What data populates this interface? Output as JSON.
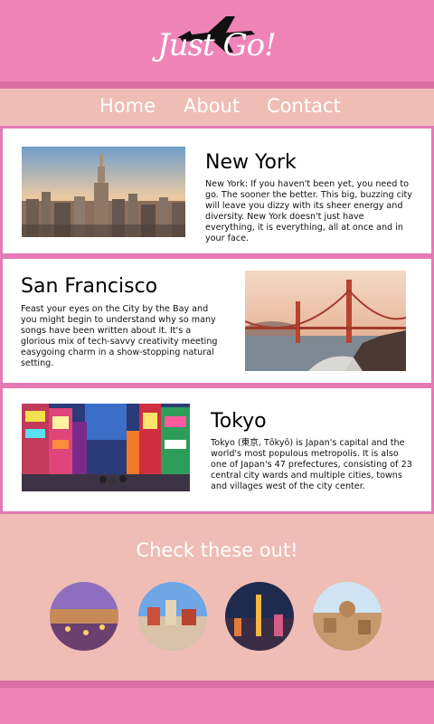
{
  "header": {
    "logo_text": "Just Go!",
    "logo_icon": "airplane-icon"
  },
  "nav": {
    "items": [
      {
        "label": "Home"
      },
      {
        "label": "About"
      },
      {
        "label": "Contact"
      }
    ]
  },
  "destinations": [
    {
      "title": "New York",
      "description": "New York: If you haven't been yet, you need to go. The sooner the better. This big, buzzing city will leave you dizzy with its sheer energy and diversity. New York doesn't just have everything, it is everything, all at once and in your face."
    },
    {
      "title": "San Francisco",
      "description": "Feast your eyes on the City by the Bay and you might begin to understand why so many songs have been written about it. It's a glorious mix of tech-savvy creativity meeting easygoing charm in a show-stopping natural setting."
    },
    {
      "title": "Tokyo",
      "description": "Tokyo (東京, Tōkyō) is Japan's capital and the world's most populous metropolis. It is also one of Japan's 47 prefectures, consisting of 23 central city wards and multiple cities, towns and villages west of the city center."
    }
  ],
  "check_out": {
    "title": "Check these out!"
  },
  "colors": {
    "header_pink": "#f084b6",
    "border_pink": "#d76fa4",
    "background_blush": "#efbdb6",
    "card_border": "#e37ab3",
    "text_white": "#ffffff"
  }
}
